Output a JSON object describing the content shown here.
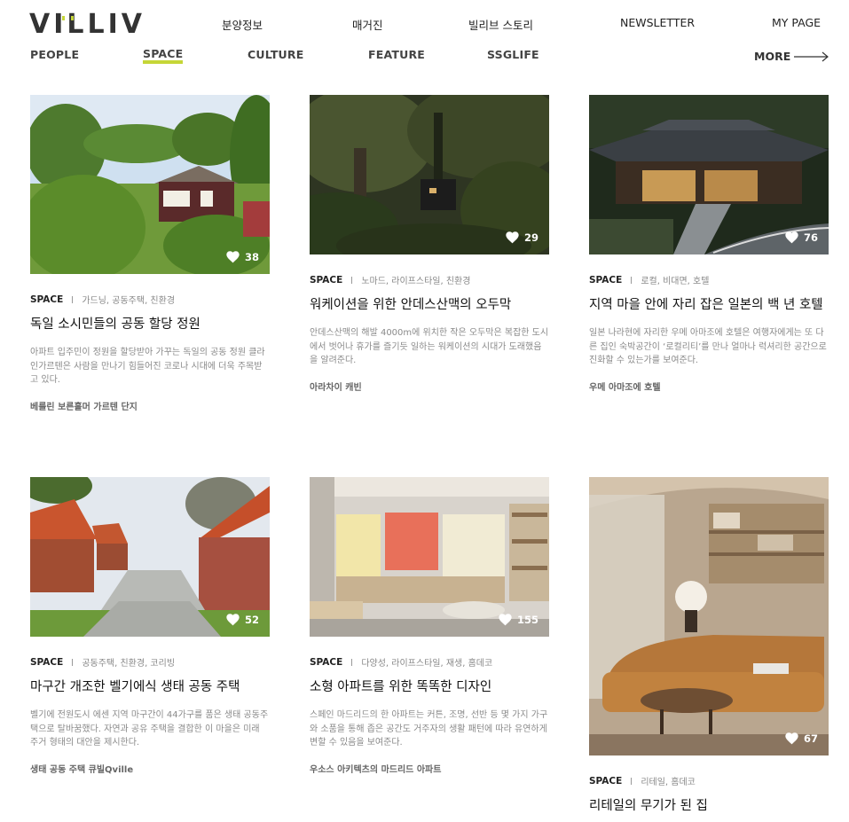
{
  "brand": {
    "logo_text": "VILLIV",
    "accent": "#c5d637"
  },
  "top_nav": [
    "분양정보",
    "매거진",
    "빌리브 스토리",
    "NEWSLETTER",
    "MY PAGE"
  ],
  "sub_nav": {
    "items": [
      "PEOPLE",
      "SPACE",
      "CULTURE",
      "FEATURE",
      "SSGLIFE"
    ],
    "active": "SPACE",
    "more_label": "MORE"
  },
  "cards": [
    {
      "likes": "38",
      "category": "SPACE",
      "tags": "가드닝, 공동주택, 친환경",
      "title": "독일 소시민들의 공동 할당 정원",
      "desc": "아파트 입주민이 정원을 할당받아 가꾸는 독일의 공동 정원 클라인가르텐은 사람을 만나기 힘들어진 코로나 시대에 더욱 주목받고 있다.",
      "place": "베를린 보른홀머 가르텐 단지"
    },
    {
      "likes": "29",
      "category": "SPACE",
      "tags": "노마드, 라이프스타일, 친환경",
      "title": "워케이션을 위한 안데스산맥의 오두막",
      "desc": "안데스산맥의 해발 4000m에 위치한 작은 오두막은 복잡한 도시에서 벗어나 휴가를 즐기듯 일하는 워케이션의 시대가 도래했음을 알려준다.",
      "place": "아라차이 캐빈"
    },
    {
      "likes": "76",
      "category": "SPACE",
      "tags": "로컬, 비대면, 호텔",
      "title": "지역 마을 안에 자리 잡은 일본의 백 년 호텔",
      "desc": "일본 나라현에 자리한 우메 아마조에 호텔은 여행자에게는 또 다른 집인 숙박공간이 ‘로컬리티’를 만나 얼마나 럭셔리한 공간으로 진화할 수 있는가를 보여준다.",
      "place": "우메 아마조에 호텔"
    },
    {
      "likes": "52",
      "category": "SPACE",
      "tags": "공동주택, 친환경, 코리빙",
      "title": "마구간 개조한 벨기에식 생태 공동 주택",
      "desc": "벨기에 전원도시 에센 지역 마구간이 44가구를 품은 생태 공동주택으로 탈바꿈했다. 자연과 공유 주택을 결합한 이 마을은 미래 주거 형태의 대안을 제시한다.",
      "place": "생태 공동 주택 큐빌Qville"
    },
    {
      "likes": "155",
      "category": "SPACE",
      "tags": "다양성, 라이프스타일, 재생, 홈데코",
      "title": "소형 아파트를 위한 똑똑한 디자인",
      "desc": "스페인 마드리드의 한 아파트는 커튼, 조명, 선반 등 몇 가지 가구와 소품을 통해 좁은 공간도 거주자의 생활 패턴에 따라 유연하게 변할 수 있음을 보여준다.",
      "place": "우소스 아키텍츠의 마드리드 아파트"
    },
    {
      "likes": "67",
      "category": "SPACE",
      "tags": "리테일, 홈데코",
      "title": "리테일의 무기가 된 집",
      "desc": "",
      "place": ""
    }
  ],
  "icons": {
    "heart": "heart-icon",
    "arrow": "arrow-right-icon"
  }
}
